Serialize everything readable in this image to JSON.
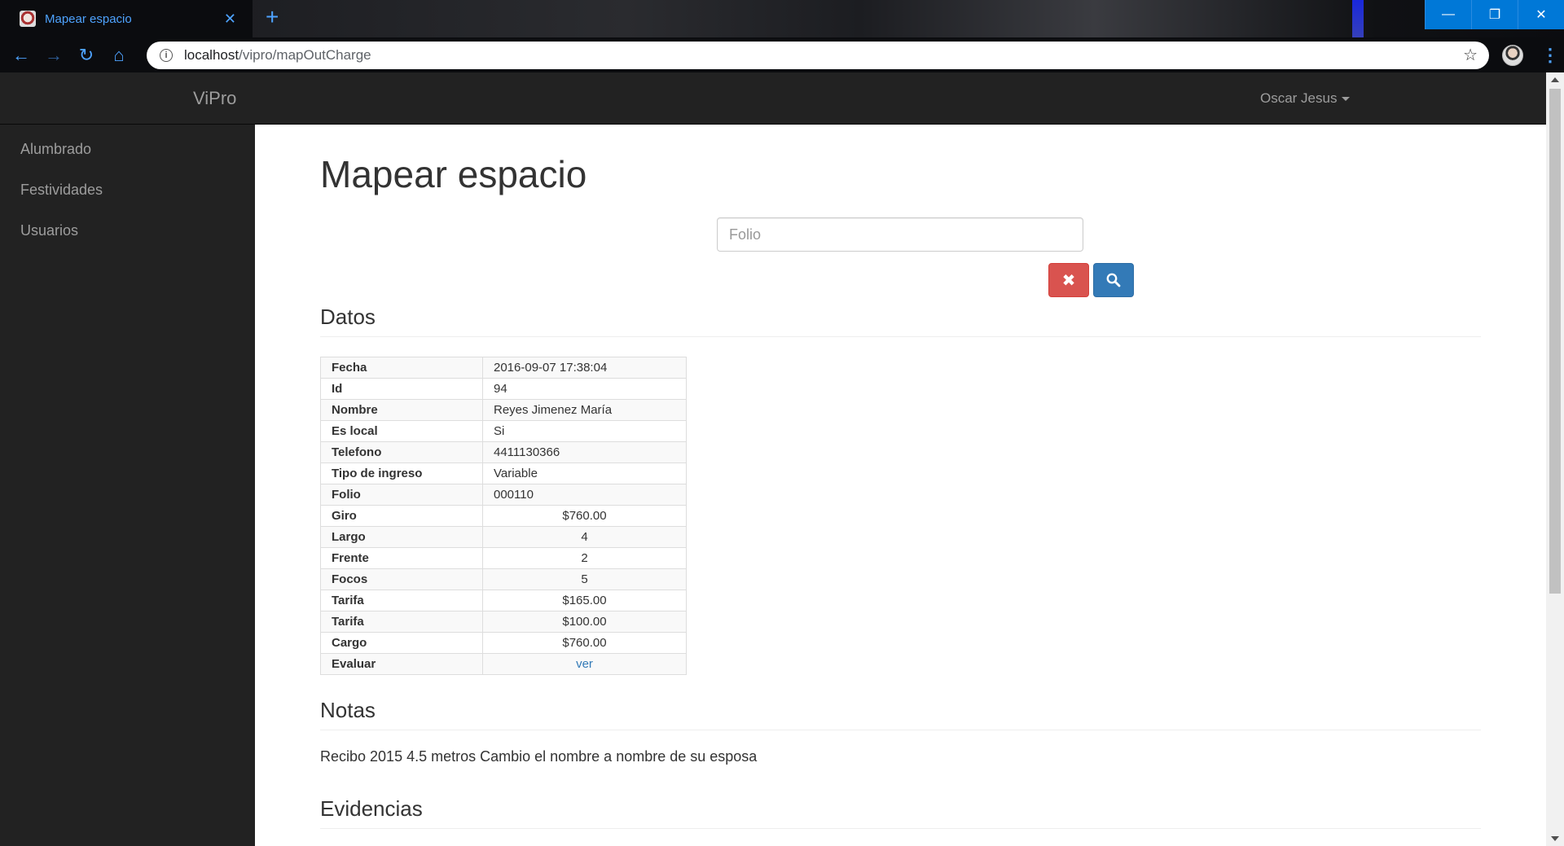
{
  "browser": {
    "tab_title": "Mapear espacio",
    "tab_close_icon": "✕",
    "new_tab_icon": "+",
    "url_host": "localhost",
    "url_path": "/vipro/mapOutCharge",
    "window_buttons": [
      "minimize",
      "restore",
      "close"
    ]
  },
  "navbar": {
    "brand": "ViPro",
    "user": "Oscar Jesus"
  },
  "sidebar": {
    "items": [
      {
        "label": "Alumbrado"
      },
      {
        "label": "Festividades"
      },
      {
        "label": "Usuarios"
      }
    ]
  },
  "page": {
    "title": "Mapear espacio",
    "search_placeholder": "Folio",
    "clear_icon": "✖",
    "search_icon": "search-icon"
  },
  "datos": {
    "heading": "Datos",
    "rows": [
      {
        "key": "Fecha",
        "value": "2016-09-07 17:38:04"
      },
      {
        "key": "Id",
        "value": "94"
      },
      {
        "key": "Nombre",
        "value": "Reyes Jimenez María"
      },
      {
        "key": "Es local",
        "value": "Si"
      },
      {
        "key": "Telefono",
        "value": "4411130366"
      },
      {
        "key": "Tipo de ingreso",
        "value": "Variable"
      },
      {
        "key": "Folio",
        "value": "000110"
      },
      {
        "key": "Giro",
        "value": "$760.00"
      },
      {
        "key": "Largo",
        "value": "4"
      },
      {
        "key": "Frente",
        "value": "2"
      },
      {
        "key": "Focos",
        "value": "5"
      },
      {
        "key": "Tarifa",
        "value": "$165.00"
      },
      {
        "key": "Tarifa",
        "value": "$100.00"
      },
      {
        "key": "Cargo",
        "value": "$760.00"
      },
      {
        "key": "Evaluar",
        "value": "ver"
      }
    ]
  },
  "notas": {
    "heading": "Notas",
    "text": "Recibo 2015 4.5 metros Cambio el nombre a nombre de su esposa"
  },
  "evidencias": {
    "heading": "Evidencias"
  }
}
